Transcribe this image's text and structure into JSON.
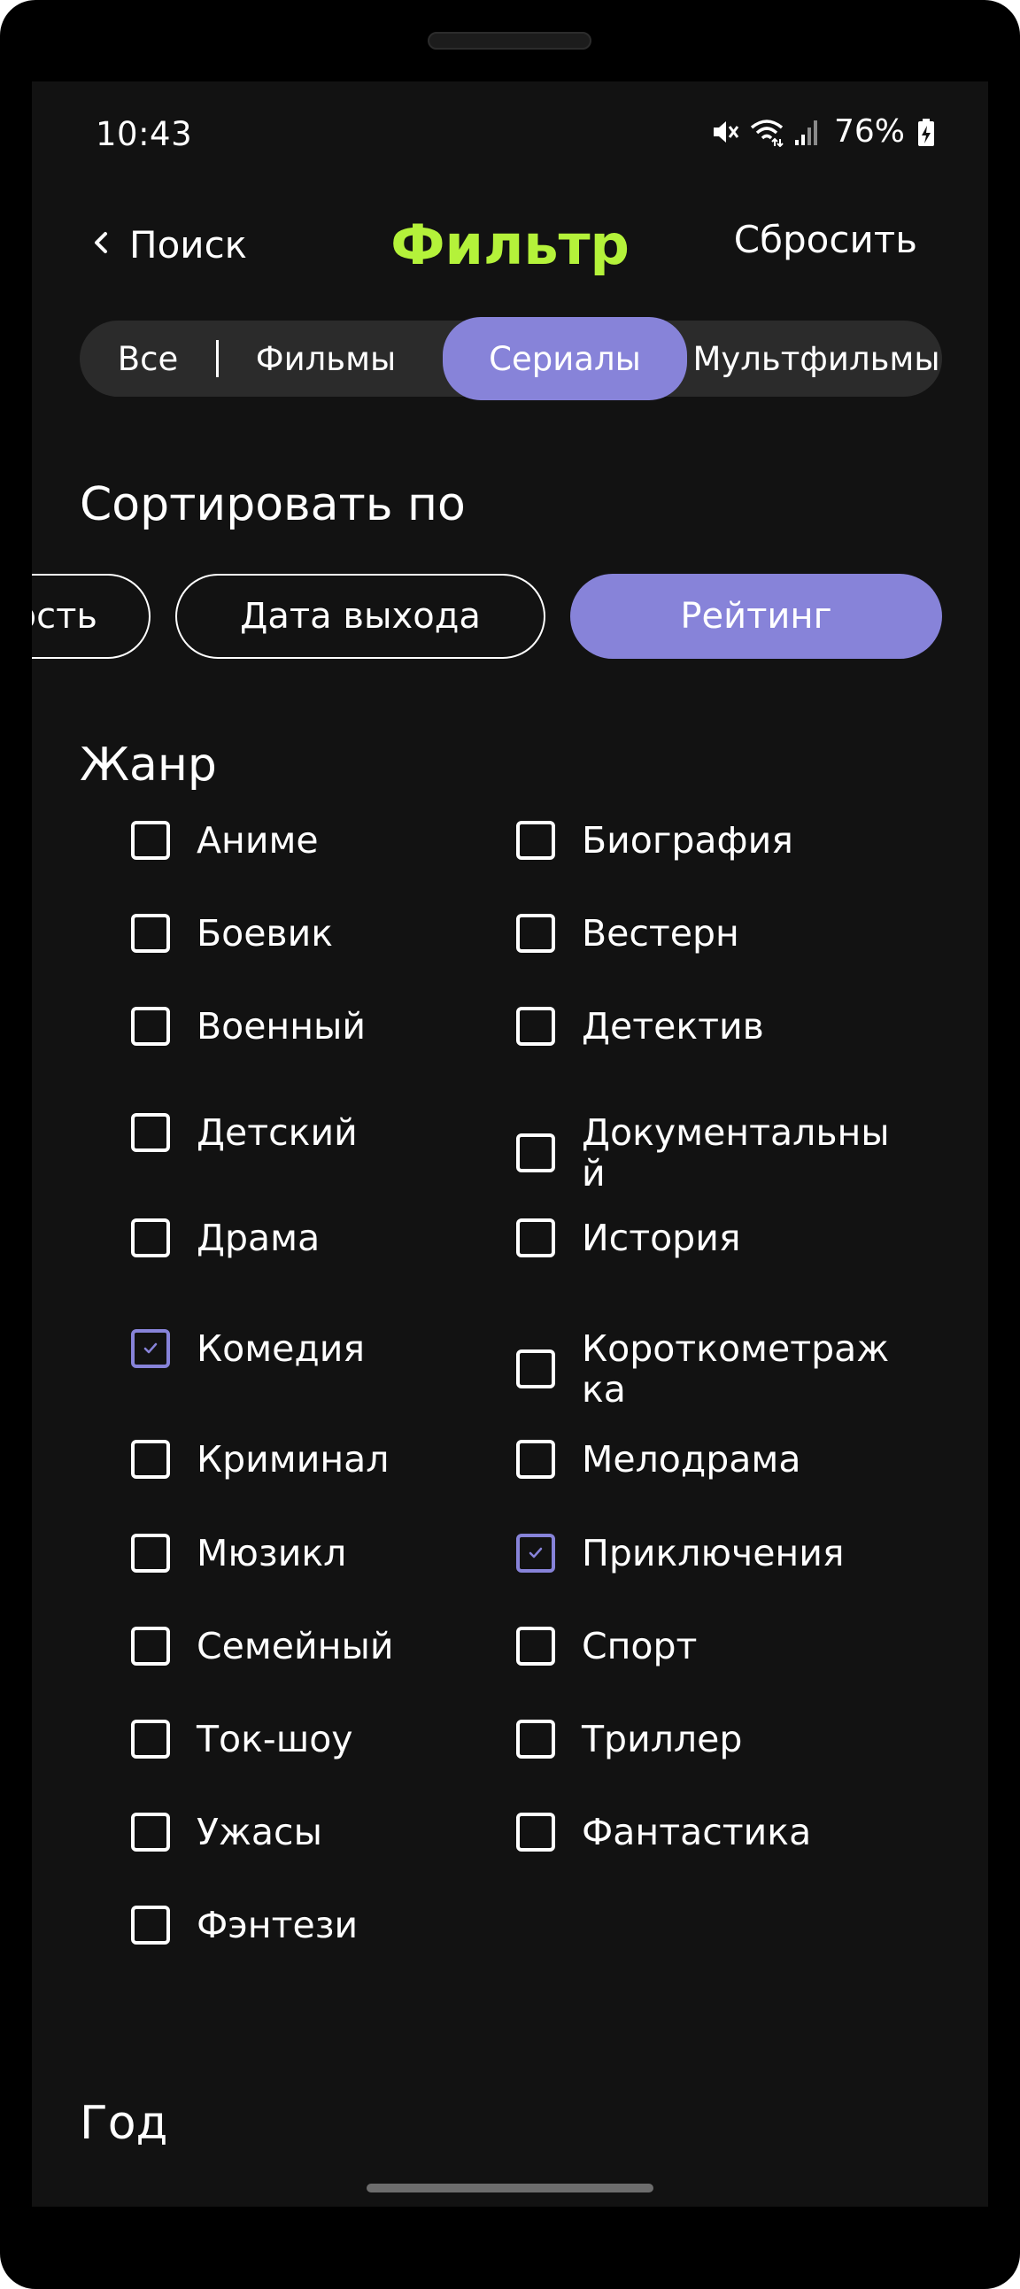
{
  "status_bar": {
    "time": "10:43",
    "battery": "76%"
  },
  "header": {
    "back_label": "Поиск",
    "title": "Фильтр",
    "reset_label": "Сбросить"
  },
  "segments": {
    "items": [
      "Все",
      "Фильмы",
      "Сериалы",
      "Мультфильмы"
    ],
    "active": "Сериалы"
  },
  "sort": {
    "title": "Сортировать по",
    "options": [
      "ость",
      "Дата выхода",
      "Рейтинг"
    ],
    "active": "Рейтинг"
  },
  "genres": {
    "title": "Жанр",
    "items": [
      {
        "label": "Аниме",
        "checked": false
      },
      {
        "label": "Биография",
        "checked": false
      },
      {
        "label": "Боевик",
        "checked": false
      },
      {
        "label": "Вестерн",
        "checked": false
      },
      {
        "label": "Военный",
        "checked": false
      },
      {
        "label": "Детектив",
        "checked": false
      },
      {
        "label": "Детский",
        "checked": false
      },
      {
        "label": "Документальный",
        "checked": false
      },
      {
        "label": "Драма",
        "checked": false
      },
      {
        "label": "История",
        "checked": false
      },
      {
        "label": "Комедия",
        "checked": true
      },
      {
        "label": "Короткометражка",
        "checked": false
      },
      {
        "label": "Криминал",
        "checked": false
      },
      {
        "label": "Мелодрама",
        "checked": false
      },
      {
        "label": "Мюзикл",
        "checked": false
      },
      {
        "label": "Приключения",
        "checked": true
      },
      {
        "label": "Семейный",
        "checked": false
      },
      {
        "label": "Спорт",
        "checked": false
      },
      {
        "label": "Ток-шоу",
        "checked": false
      },
      {
        "label": "Триллер",
        "checked": false
      },
      {
        "label": "Ужасы",
        "checked": false
      },
      {
        "label": "Фантастика",
        "checked": false
      },
      {
        "label": "Фэнтези",
        "checked": false
      }
    ]
  },
  "year": {
    "title": "Год"
  },
  "colors": {
    "accent_green": "#b4f23a",
    "accent_purple": "#8783d9",
    "background": "#121212"
  }
}
